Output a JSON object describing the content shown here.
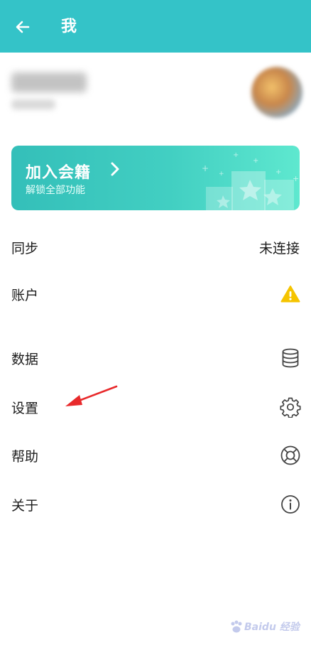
{
  "header": {
    "title": "我",
    "background": "#34c3c8",
    "back_icon": "arrow-left-icon"
  },
  "member": {
    "title": "加入会籍",
    "subtitle": "解锁全部功能",
    "chevron_icon": "chevron-right-icon"
  },
  "menu": [
    {
      "key": "sync",
      "label": "同步",
      "value": "未连接"
    },
    {
      "key": "account",
      "label": "账户",
      "icon": "warning-icon",
      "icon_color": "#f5c400"
    },
    {
      "key": "data",
      "label": "数据",
      "icon": "database-icon"
    },
    {
      "key": "settings",
      "label": "设置",
      "icon": "gear-icon"
    },
    {
      "key": "help",
      "label": "帮助",
      "icon": "lifebuoy-icon"
    },
    {
      "key": "about",
      "label": "关于",
      "icon": "info-icon"
    }
  ],
  "annotation": {
    "arrow_color": "#e8292b"
  },
  "watermark": {
    "text": "Baidu 经验"
  }
}
